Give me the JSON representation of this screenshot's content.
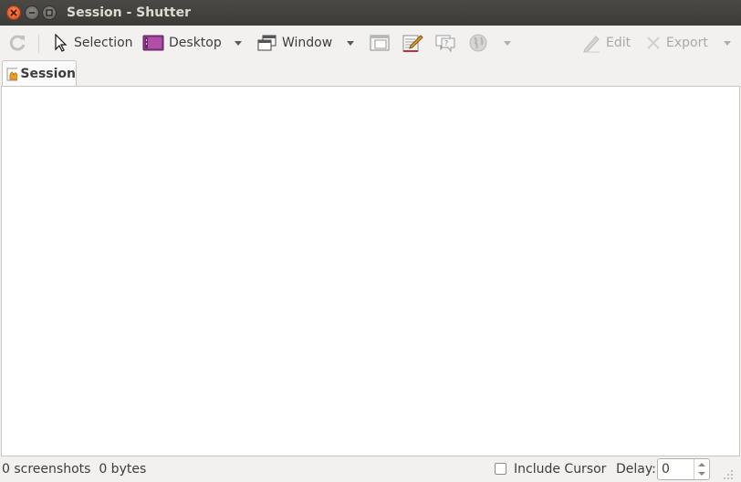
{
  "window": {
    "title": "Session - Shutter"
  },
  "toolbar": {
    "selection_label": "Selection",
    "desktop_label": "Desktop",
    "window_label": "Window",
    "edit_label": "Edit",
    "export_label": "Export"
  },
  "tabs": [
    {
      "label": "Session"
    }
  ],
  "statusbar": {
    "count_text": "0 screenshots",
    "size_text": "0 bytes",
    "include_cursor_label": "Include Cursor",
    "include_cursor_checked": false,
    "delay_label": "Delay:",
    "delay_value": "0"
  },
  "icons": {
    "refresh": "refresh-icon",
    "selection": "cursor-arrow-icon",
    "desktop": "desktop-icon",
    "window": "window-icon",
    "menu": "menu-capture-icon",
    "tooltip": "tooltip-capture-icon",
    "web": "web-capture-icon",
    "editor": "editor-icon",
    "export": "export-icon"
  },
  "colors": {
    "titlebar": "#3c3b37",
    "close_button": "#dd4814",
    "toolbar_bg": "#f2f1f0",
    "desktop_icon": "#8e3a8a"
  }
}
